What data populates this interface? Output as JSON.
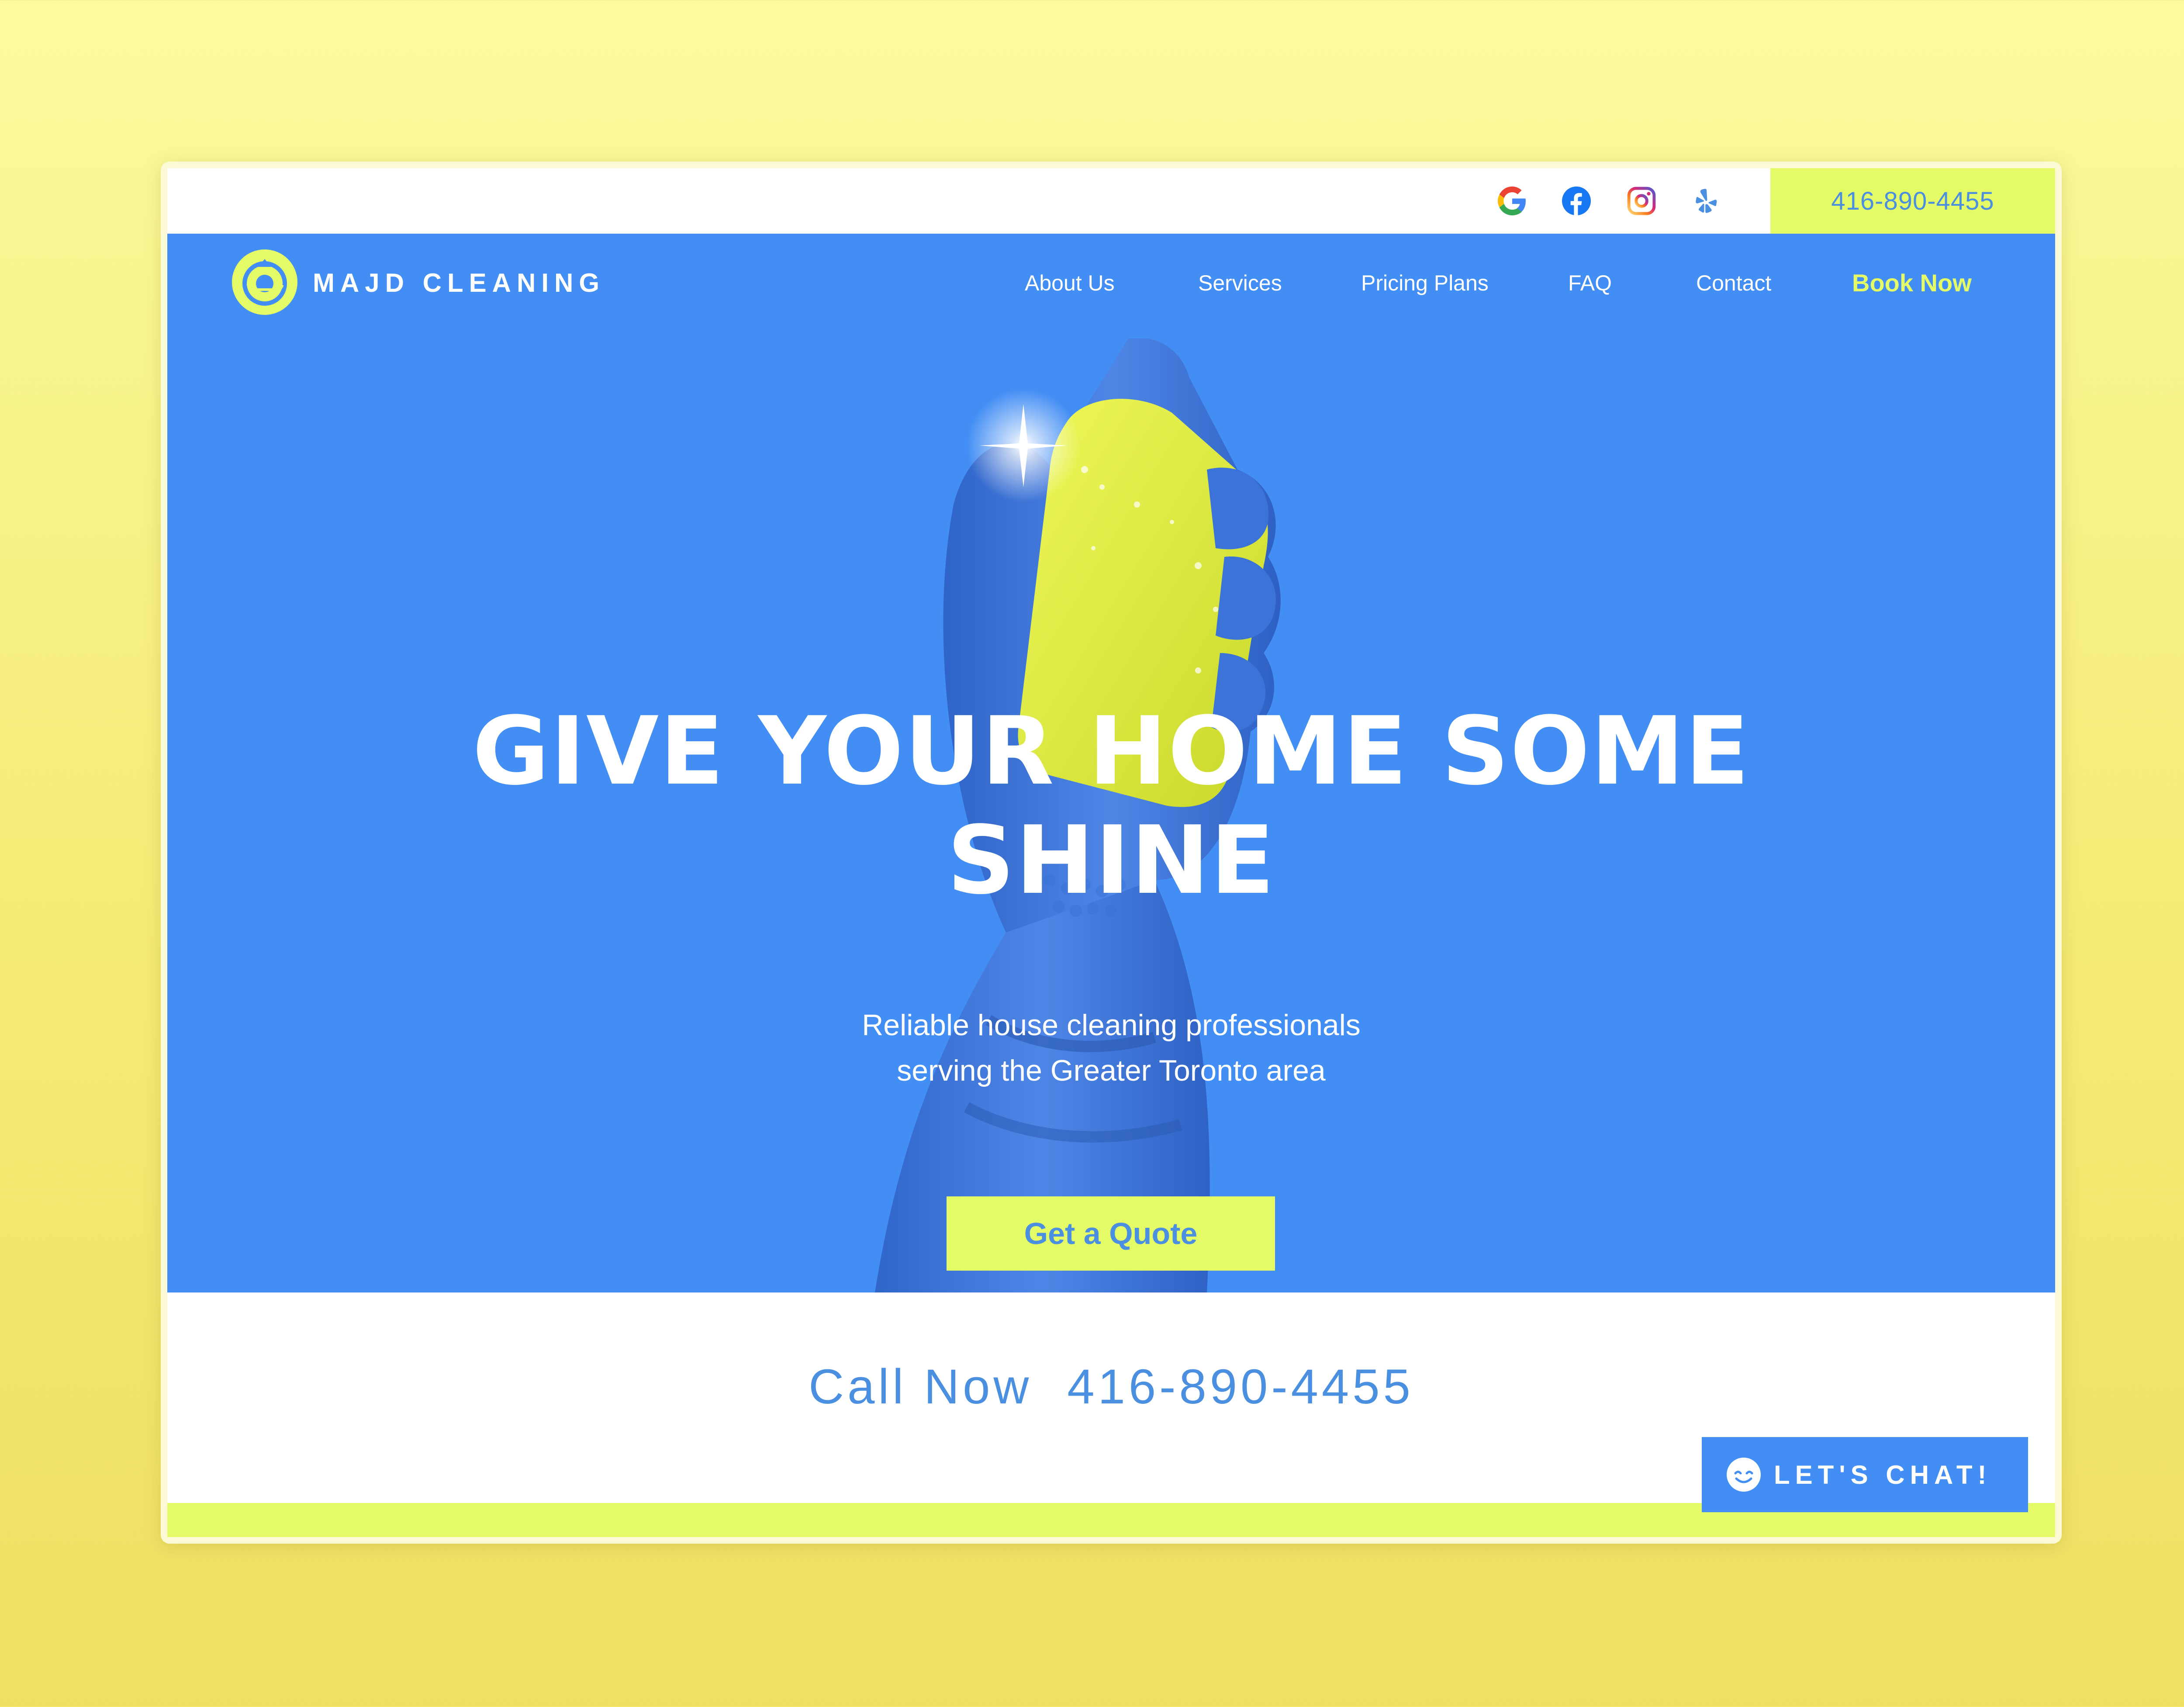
{
  "topbar": {
    "social_icons": [
      "google-icon",
      "facebook-icon",
      "instagram-icon",
      "yelp-icon"
    ],
    "phone": "416-890-4455"
  },
  "header": {
    "brand": "MAJD CLEANING",
    "nav": [
      {
        "label": "About Us"
      },
      {
        "label": "Services"
      },
      {
        "label": "Pricing Plans"
      },
      {
        "label": "FAQ"
      },
      {
        "label": "Contact"
      }
    ],
    "book_now": "Book Now"
  },
  "hero": {
    "headline_line1": "GIVE YOUR HOME SOME",
    "headline_line2": "SHINE",
    "subtitle_line1": "Reliable house cleaning professionals",
    "subtitle_line2": "serving the Greater Toronto area",
    "cta": "Get a Quote"
  },
  "call": {
    "label": "Call Now",
    "phone": "416-890-4455"
  },
  "chat": {
    "label": "LET'S CHAT!",
    "icon": "smiley-icon"
  },
  "colors": {
    "primary_blue": "#438ef4",
    "accent_lime": "#e4fa66",
    "text_blue": "#4a8fe0"
  }
}
